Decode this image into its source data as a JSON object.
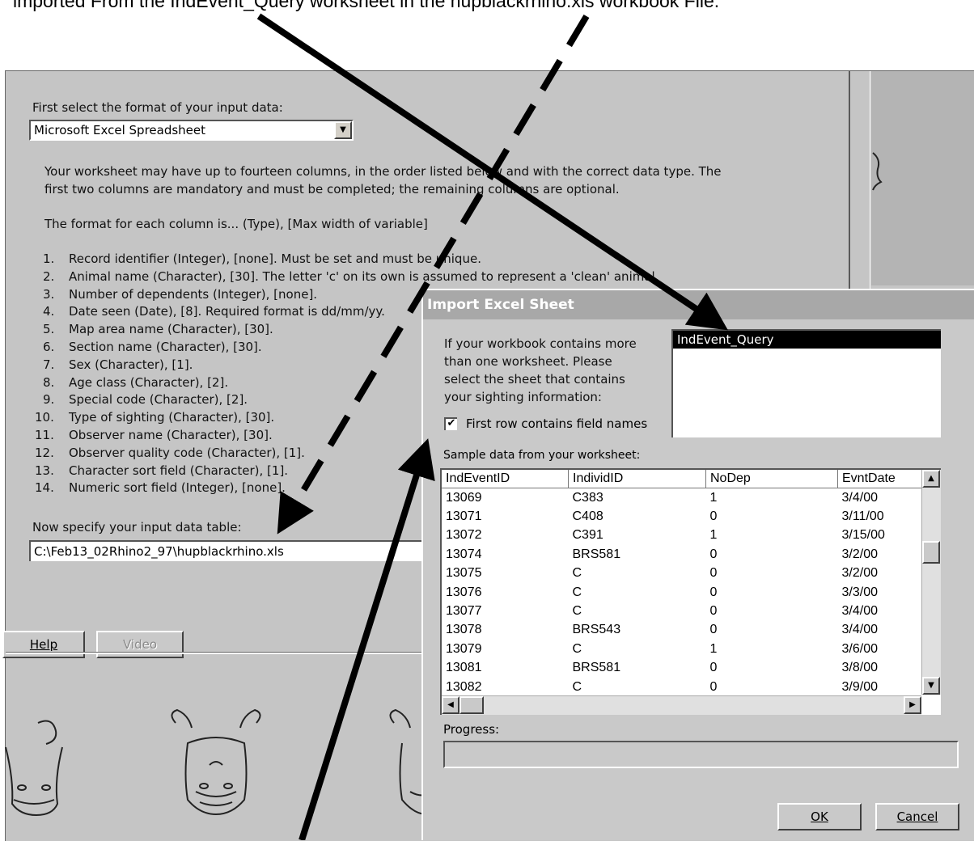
{
  "caption": "imported From the IndEvent_Query worksheet in the hupblackrhino.xls workbook File.",
  "main": {
    "format_label": "First select the format of your input data:",
    "format_value": "Microsoft Excel Spreadsheet",
    "intro_line1": "Your worksheet may have up to fourteen columns, in the order listed below and with the correct data type.  The",
    "intro_line2": "first two columns are mandatory and must be completed; the remaining columns are optional.",
    "format_line": "The format for each column is... (Type), [Max width of variable]",
    "columns": [
      {
        "num": "1.",
        "text": "Record identifier (Integer), [none]. Must be set and must be unique."
      },
      {
        "num": "2.",
        "text": "Animal name (Character), [30].  The letter 'c' on its own is assumed to represent a 'clean' animal."
      },
      {
        "num": "3.",
        "text": "Number of dependents (Integer), [none]."
      },
      {
        "num": "4.",
        "text": "Date seen (Date), [8].  Required format is dd/mm/yy."
      },
      {
        "num": "5.",
        "text": "Map area name (Character), [30]."
      },
      {
        "num": "6.",
        "text": "Section name (Character), [30]."
      },
      {
        "num": "7.",
        "text": "Sex (Character), [1]."
      },
      {
        "num": "8.",
        "text": "Age class (Character), [2]."
      },
      {
        "num": "9.",
        "text": "Special code (Character), [2]."
      },
      {
        "num": "10.",
        "text": "Type of sighting (Character), [30]."
      },
      {
        "num": "11.",
        "text": "Observer name (Character), [30]."
      },
      {
        "num": "12.",
        "text": "Observer quality code (Character), [1]."
      },
      {
        "num": "13.",
        "text": "Character sort field (Character), [1]."
      },
      {
        "num": "14.",
        "text": "Numeric sort field (Integer), [none]."
      }
    ],
    "table_label": "Now specify your input data table:",
    "table_path": "C:\\Feb13_02Rhino2_97\\hupblackrhino.xls",
    "help_label": "Help",
    "video_label": "Video"
  },
  "dialog": {
    "title": "Import Excel Sheet",
    "instructions": [
      "If your workbook contains more",
      "than one worksheet.  Please",
      "select the sheet that contains",
      "your sighting information:"
    ],
    "sheets": [
      "IndEvent_Query"
    ],
    "first_row_label": "First row contains field names",
    "first_row_checked": true,
    "sample_label": "Sample data from your worksheet:",
    "columns": [
      "IndEventID",
      "IndividID",
      "NoDep",
      "EvntDate"
    ],
    "rows": [
      [
        "13069",
        "C383",
        "1",
        "3/4/00"
      ],
      [
        "13071",
        "C408",
        "0",
        "3/11/00"
      ],
      [
        "13072",
        "C391",
        "1",
        "3/15/00"
      ],
      [
        "13074",
        "BRS581",
        "0",
        "3/2/00"
      ],
      [
        "13075",
        "C",
        "0",
        "3/2/00"
      ],
      [
        "13076",
        "C",
        "0",
        "3/3/00"
      ],
      [
        "13077",
        "C",
        "0",
        "3/4/00"
      ],
      [
        "13078",
        "BRS543",
        "0",
        "3/4/00"
      ],
      [
        "13079",
        "C",
        "1",
        "3/6/00"
      ],
      [
        "13081",
        "BRS581",
        "0",
        "3/8/00"
      ],
      [
        "13082",
        "C",
        "0",
        "3/9/00"
      ]
    ],
    "progress_label": "Progress:",
    "progress_value": 0,
    "ok_label": "OK",
    "cancel_label": "Cancel"
  }
}
